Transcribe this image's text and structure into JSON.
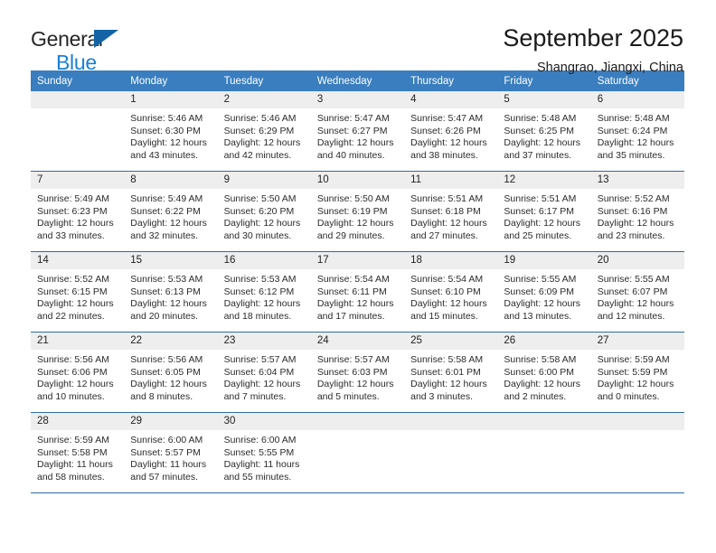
{
  "brand": {
    "line1": "General",
    "line2": "Blue",
    "triangle_color": "#1464a5",
    "blue_color": "#1b7fd4"
  },
  "header": {
    "title": "September 2025",
    "subtitle": "Shangrao, Jiangxi, China"
  },
  "theme": {
    "header_bg": "#3a7ebf",
    "row_divider": "#2e6da4",
    "daynum_bg": "#eeeeee"
  },
  "weekday_headers": [
    "Sunday",
    "Monday",
    "Tuesday",
    "Wednesday",
    "Thursday",
    "Friday",
    "Saturday"
  ],
  "weeks": [
    [
      {
        "day": "",
        "blank": true,
        "sunrise": "",
        "sunset": "",
        "daylight1": "",
        "daylight2": ""
      },
      {
        "day": "1",
        "sunrise": "Sunrise: 5:46 AM",
        "sunset": "Sunset: 6:30 PM",
        "daylight1": "Daylight: 12 hours",
        "daylight2": "and 43 minutes."
      },
      {
        "day": "2",
        "sunrise": "Sunrise: 5:46 AM",
        "sunset": "Sunset: 6:29 PM",
        "daylight1": "Daylight: 12 hours",
        "daylight2": "and 42 minutes."
      },
      {
        "day": "3",
        "sunrise": "Sunrise: 5:47 AM",
        "sunset": "Sunset: 6:27 PM",
        "daylight1": "Daylight: 12 hours",
        "daylight2": "and 40 minutes."
      },
      {
        "day": "4",
        "sunrise": "Sunrise: 5:47 AM",
        "sunset": "Sunset: 6:26 PM",
        "daylight1": "Daylight: 12 hours",
        "daylight2": "and 38 minutes."
      },
      {
        "day": "5",
        "sunrise": "Sunrise: 5:48 AM",
        "sunset": "Sunset: 6:25 PM",
        "daylight1": "Daylight: 12 hours",
        "daylight2": "and 37 minutes."
      },
      {
        "day": "6",
        "sunrise": "Sunrise: 5:48 AM",
        "sunset": "Sunset: 6:24 PM",
        "daylight1": "Daylight: 12 hours",
        "daylight2": "and 35 minutes."
      }
    ],
    [
      {
        "day": "7",
        "sunrise": "Sunrise: 5:49 AM",
        "sunset": "Sunset: 6:23 PM",
        "daylight1": "Daylight: 12 hours",
        "daylight2": "and 33 minutes."
      },
      {
        "day": "8",
        "sunrise": "Sunrise: 5:49 AM",
        "sunset": "Sunset: 6:22 PM",
        "daylight1": "Daylight: 12 hours",
        "daylight2": "and 32 minutes."
      },
      {
        "day": "9",
        "sunrise": "Sunrise: 5:50 AM",
        "sunset": "Sunset: 6:20 PM",
        "daylight1": "Daylight: 12 hours",
        "daylight2": "and 30 minutes."
      },
      {
        "day": "10",
        "sunrise": "Sunrise: 5:50 AM",
        "sunset": "Sunset: 6:19 PM",
        "daylight1": "Daylight: 12 hours",
        "daylight2": "and 29 minutes."
      },
      {
        "day": "11",
        "sunrise": "Sunrise: 5:51 AM",
        "sunset": "Sunset: 6:18 PM",
        "daylight1": "Daylight: 12 hours",
        "daylight2": "and 27 minutes."
      },
      {
        "day": "12",
        "sunrise": "Sunrise: 5:51 AM",
        "sunset": "Sunset: 6:17 PM",
        "daylight1": "Daylight: 12 hours",
        "daylight2": "and 25 minutes."
      },
      {
        "day": "13",
        "sunrise": "Sunrise: 5:52 AM",
        "sunset": "Sunset: 6:16 PM",
        "daylight1": "Daylight: 12 hours",
        "daylight2": "and 23 minutes."
      }
    ],
    [
      {
        "day": "14",
        "sunrise": "Sunrise: 5:52 AM",
        "sunset": "Sunset: 6:15 PM",
        "daylight1": "Daylight: 12 hours",
        "daylight2": "and 22 minutes."
      },
      {
        "day": "15",
        "sunrise": "Sunrise: 5:53 AM",
        "sunset": "Sunset: 6:13 PM",
        "daylight1": "Daylight: 12 hours",
        "daylight2": "and 20 minutes."
      },
      {
        "day": "16",
        "sunrise": "Sunrise: 5:53 AM",
        "sunset": "Sunset: 6:12 PM",
        "daylight1": "Daylight: 12 hours",
        "daylight2": "and 18 minutes."
      },
      {
        "day": "17",
        "sunrise": "Sunrise: 5:54 AM",
        "sunset": "Sunset: 6:11 PM",
        "daylight1": "Daylight: 12 hours",
        "daylight2": "and 17 minutes."
      },
      {
        "day": "18",
        "sunrise": "Sunrise: 5:54 AM",
        "sunset": "Sunset: 6:10 PM",
        "daylight1": "Daylight: 12 hours",
        "daylight2": "and 15 minutes."
      },
      {
        "day": "19",
        "sunrise": "Sunrise: 5:55 AM",
        "sunset": "Sunset: 6:09 PM",
        "daylight1": "Daylight: 12 hours",
        "daylight2": "and 13 minutes."
      },
      {
        "day": "20",
        "sunrise": "Sunrise: 5:55 AM",
        "sunset": "Sunset: 6:07 PM",
        "daylight1": "Daylight: 12 hours",
        "daylight2": "and 12 minutes."
      }
    ],
    [
      {
        "day": "21",
        "sunrise": "Sunrise: 5:56 AM",
        "sunset": "Sunset: 6:06 PM",
        "daylight1": "Daylight: 12 hours",
        "daylight2": "and 10 minutes."
      },
      {
        "day": "22",
        "sunrise": "Sunrise: 5:56 AM",
        "sunset": "Sunset: 6:05 PM",
        "daylight1": "Daylight: 12 hours",
        "daylight2": "and 8 minutes."
      },
      {
        "day": "23",
        "sunrise": "Sunrise: 5:57 AM",
        "sunset": "Sunset: 6:04 PM",
        "daylight1": "Daylight: 12 hours",
        "daylight2": "and 7 minutes."
      },
      {
        "day": "24",
        "sunrise": "Sunrise: 5:57 AM",
        "sunset": "Sunset: 6:03 PM",
        "daylight1": "Daylight: 12 hours",
        "daylight2": "and 5 minutes."
      },
      {
        "day": "25",
        "sunrise": "Sunrise: 5:58 AM",
        "sunset": "Sunset: 6:01 PM",
        "daylight1": "Daylight: 12 hours",
        "daylight2": "and 3 minutes."
      },
      {
        "day": "26",
        "sunrise": "Sunrise: 5:58 AM",
        "sunset": "Sunset: 6:00 PM",
        "daylight1": "Daylight: 12 hours",
        "daylight2": "and 2 minutes."
      },
      {
        "day": "27",
        "sunrise": "Sunrise: 5:59 AM",
        "sunset": "Sunset: 5:59 PM",
        "daylight1": "Daylight: 12 hours",
        "daylight2": "and 0 minutes."
      }
    ],
    [
      {
        "day": "28",
        "sunrise": "Sunrise: 5:59 AM",
        "sunset": "Sunset: 5:58 PM",
        "daylight1": "Daylight: 11 hours",
        "daylight2": "and 58 minutes."
      },
      {
        "day": "29",
        "sunrise": "Sunrise: 6:00 AM",
        "sunset": "Sunset: 5:57 PM",
        "daylight1": "Daylight: 11 hours",
        "daylight2": "and 57 minutes."
      },
      {
        "day": "30",
        "sunrise": "Sunrise: 6:00 AM",
        "sunset": "Sunset: 5:55 PM",
        "daylight1": "Daylight: 11 hours",
        "daylight2": "and 55 minutes."
      },
      {
        "day": "",
        "blank": true,
        "sunrise": "",
        "sunset": "",
        "daylight1": "",
        "daylight2": ""
      },
      {
        "day": "",
        "blank": true,
        "sunrise": "",
        "sunset": "",
        "daylight1": "",
        "daylight2": ""
      },
      {
        "day": "",
        "blank": true,
        "sunrise": "",
        "sunset": "",
        "daylight1": "",
        "daylight2": ""
      },
      {
        "day": "",
        "blank": true,
        "sunrise": "",
        "sunset": "",
        "daylight1": "",
        "daylight2": ""
      }
    ]
  ]
}
